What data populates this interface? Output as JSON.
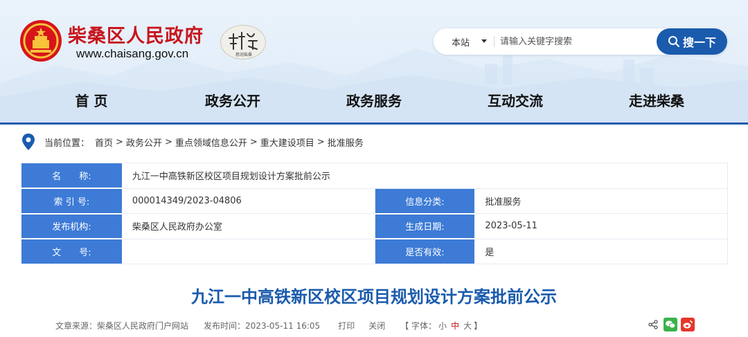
{
  "header": {
    "site_name": "柴桑区人民政府",
    "site_url": "www.chaisang.gov.cn",
    "badge_caption": "慈润柴桑",
    "search": {
      "scope_label": "本站",
      "placeholder": "请输入关键字搜索",
      "button_label": "搜一下"
    }
  },
  "nav": {
    "items": [
      {
        "label": "首 页"
      },
      {
        "label": "政务公开"
      },
      {
        "label": "政务服务"
      },
      {
        "label": "互动交流"
      },
      {
        "label": "走进柴桑"
      }
    ]
  },
  "breadcrumb": {
    "prefix": "当前位置：",
    "items": [
      "首页",
      "政务公开",
      "重点领域信息公开",
      "重大建设项目",
      "批准服务"
    ],
    "separator": ">"
  },
  "info": {
    "name_label": "名　　称:",
    "name_value": "九江一中高铁新区校区项目规划设计方案批前公示",
    "index_label": "索 引 号:",
    "index_value": "000014349/2023-04806",
    "category_label": "信息分类:",
    "category_value": "批准服务",
    "publisher_label": "发布机构:",
    "publisher_value": "柴桑区人民政府办公室",
    "date_label": "生成日期:",
    "date_value": "2023-05-11",
    "doc_no_label": "文　　号:",
    "doc_no_value": "",
    "valid_label": "是否有效:",
    "valid_value": "是"
  },
  "article": {
    "title": "九江一中高铁新区校区项目规划设计方案批前公示",
    "source_label": "文章来源：",
    "source_value": "柴桑区人民政府门户网站",
    "time_label": "发布时间：",
    "time_value": "2023-05-11 16:05",
    "print_label": "打印",
    "close_label": "关闭",
    "font_prefix": "【 字体：",
    "font_small": "小",
    "font_medium": "中",
    "font_large": "大",
    "font_suffix": "】"
  },
  "colors": {
    "brand_red": "#c8161d",
    "brand_blue": "#1a5bad",
    "label_blue": "#3d7bd6",
    "wechat_green": "#3bb24a",
    "weibo_red": "#e6362a"
  },
  "icons": {
    "logo": "national-emblem",
    "location": "location-pin-icon",
    "search": "magnifier-icon",
    "share": "share-icon",
    "wechat": "wechat-icon",
    "weibo": "weibo-icon"
  }
}
